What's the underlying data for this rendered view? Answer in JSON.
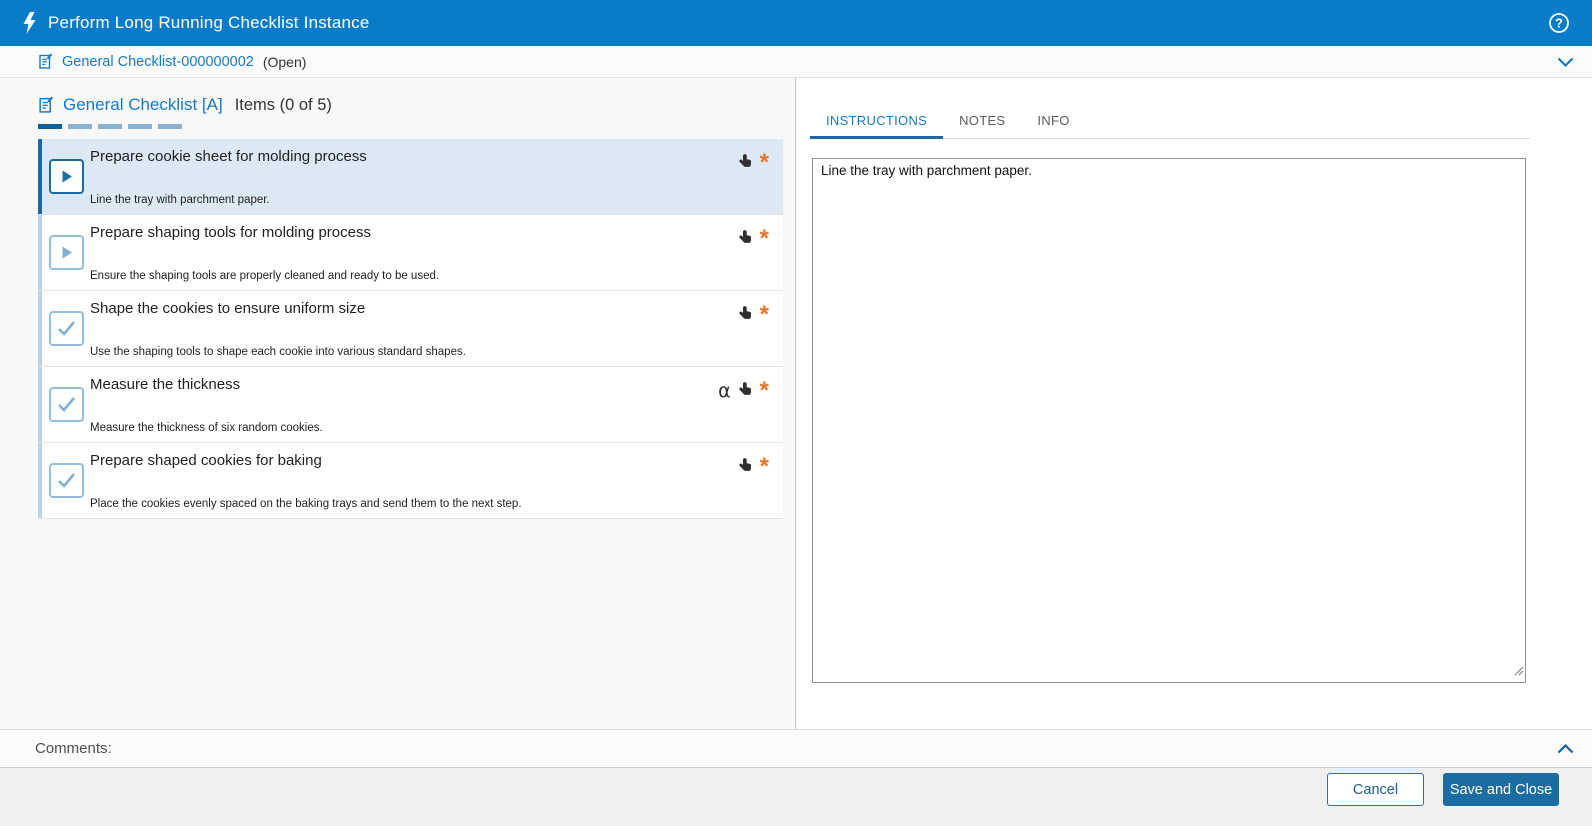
{
  "header": {
    "title": "Perform Long Running Checklist Instance"
  },
  "subheader": {
    "link_label": "General Checklist-000000002",
    "status": "(Open)"
  },
  "left_panel": {
    "link_label": "General Checklist [A]",
    "items_count_label": "Items (0 of 5)",
    "progress": {
      "total": 5,
      "current_segment": 1
    },
    "items": [
      {
        "title": "Prepare cookie sheet for molding process",
        "description": "Line the tray with parchment paper.",
        "control": "play",
        "selected": true,
        "alpha": false,
        "required": true
      },
      {
        "title": "Prepare shaping tools for molding process",
        "description": "Ensure the shaping tools are properly cleaned and ready to be used.",
        "control": "play",
        "selected": false,
        "alpha": false,
        "required": true
      },
      {
        "title": "Shape the cookies to ensure uniform size",
        "description": "Use the shaping tools to shape each cookie into various standard shapes.",
        "control": "checkbox",
        "selected": false,
        "alpha": false,
        "required": true
      },
      {
        "title": "Measure the thickness",
        "description": "Measure the thickness of six random cookies.",
        "control": "checkbox",
        "selected": false,
        "alpha": true,
        "required": true
      },
      {
        "title": "Prepare shaped cookies for baking",
        "description": "Place the cookies evenly spaced on the baking trays and send them to the next step.",
        "control": "checkbox",
        "selected": false,
        "alpha": false,
        "required": true
      }
    ]
  },
  "right_panel": {
    "tabs": [
      {
        "label": "INSTRUCTIONS",
        "active": true
      },
      {
        "label": "NOTES",
        "active": false
      },
      {
        "label": "INFO",
        "active": false
      }
    ],
    "instructions_text": "Line the tray with parchment paper."
  },
  "comments": {
    "label": "Comments:"
  },
  "footer": {
    "cancel_label": "Cancel",
    "save_label": "Save and Close"
  },
  "icons": [
    "lightning-icon",
    "help-icon",
    "checklist-doc-icon",
    "chevron-down-icon",
    "chevron-up-icon",
    "play-icon",
    "checkmark-icon",
    "alpha-data-icon",
    "data-collection-hand-icon",
    "required-asterisk"
  ],
  "colors": {
    "header_blue": "#0a7bc8",
    "link_blue": "#1779c6",
    "selected_row": "#dce9f4",
    "selected_strip": "#1b6ba3",
    "inactive_strip": "#b9d3e5",
    "required_orange": "#e2762b",
    "save_button": "#1b6ca1",
    "progress_done": "#0f5f9c",
    "progress_todo": "#8ab3d3"
  }
}
